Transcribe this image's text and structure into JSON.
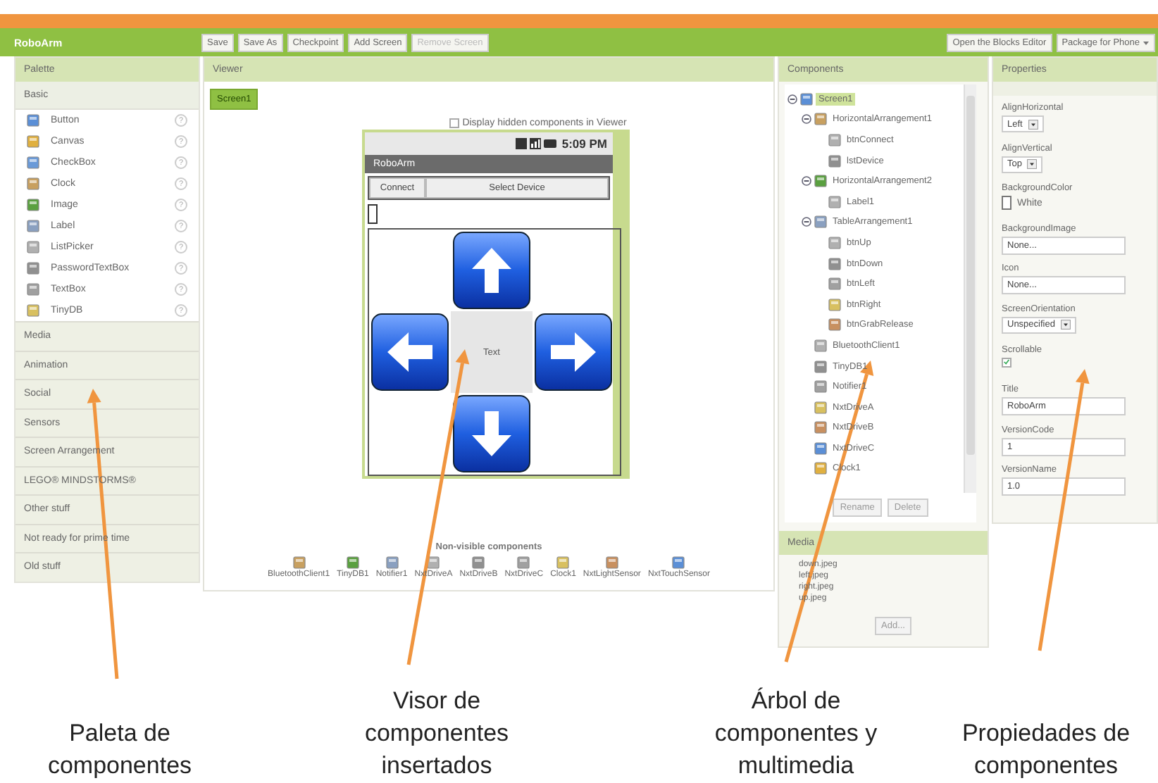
{
  "toolbar": {
    "project": "RoboArm",
    "buttons": [
      {
        "label": "Save",
        "disabled": false
      },
      {
        "label": "Save As",
        "disabled": false
      },
      {
        "label": "Checkpoint",
        "disabled": false
      },
      {
        "label": "Add Screen",
        "disabled": false
      },
      {
        "label": "Remove Screen",
        "disabled": true
      }
    ],
    "right_buttons": [
      {
        "label": "Open the Blocks Editor",
        "dropdown": false
      },
      {
        "label": "Package for Phone",
        "dropdown": true
      }
    ]
  },
  "palette": {
    "title": "Palette",
    "open_category": "Basic",
    "items": [
      {
        "label": "Button",
        "help": "?"
      },
      {
        "label": "Canvas",
        "help": "?"
      },
      {
        "label": "CheckBox",
        "help": "?"
      },
      {
        "label": "Clock",
        "help": "?"
      },
      {
        "label": "Image",
        "help": "?"
      },
      {
        "label": "Label",
        "help": "?"
      },
      {
        "label": "ListPicker",
        "help": "?"
      },
      {
        "label": "PasswordTextBox",
        "help": "?"
      },
      {
        "label": "TextBox",
        "help": "?"
      },
      {
        "label": "TinyDB",
        "help": "?"
      }
    ],
    "categories": [
      "Media",
      "Animation",
      "Social",
      "Sensors",
      "Screen Arrangement",
      "LEGO® MINDSTORMS®",
      "Other stuff",
      "Not ready for prime time",
      "Old stuff"
    ]
  },
  "viewer": {
    "title": "Viewer",
    "screen_tab": {
      "label": "Screen1",
      "selected": true
    },
    "display_hidden": {
      "label": "Display hidden components in Viewer",
      "checked": false
    },
    "phone": {
      "time": "5:09 PM",
      "app_title": "RoboArm",
      "connect": "Connect",
      "select_device": "Select Device",
      "pad": [
        {
          "kind": "arrow_up"
        },
        {
          "kind": "arrow_left"
        },
        {
          "kind": "center",
          "label": "Text"
        },
        {
          "kind": "arrow_right"
        },
        {
          "kind": "arrow_down"
        }
      ]
    },
    "non_visible_title": "Non-visible components",
    "non_visible": [
      "BluetoothClient1",
      "TinyDB1",
      "Notifier1",
      "NxtDriveA",
      "NxtDriveB",
      "NxtDriveC",
      "Clock1",
      "NxtLightSensor",
      "NxtTouchSensor"
    ]
  },
  "components": {
    "title": "Components",
    "tree": [
      {
        "label": "Screen1",
        "selected": true,
        "expanded": true,
        "children": [
          {
            "label": "HorizontalArrangement1",
            "selected": false,
            "expanded": true,
            "children": [
              {
                "label": "btnConnect",
                "selected": false
              },
              {
                "label": "lstDevice",
                "selected": false
              }
            ]
          },
          {
            "label": "HorizontalArrangement2",
            "selected": false,
            "expanded": true,
            "children": [
              {
                "label": "Label1",
                "selected": false
              }
            ]
          },
          {
            "label": "TableArrangement1",
            "selected": false,
            "expanded": true,
            "children": [
              {
                "label": "btnUp",
                "selected": false
              },
              {
                "label": "btnDown",
                "selected": false
              },
              {
                "label": "btnLeft",
                "selected": false
              },
              {
                "label": "btnRight",
                "selected": false
              },
              {
                "label": "btnGrabRelease",
                "selected": false
              }
            ]
          },
          {
            "label": "BluetoothClient1",
            "selected": false
          },
          {
            "label": "TinyDB1",
            "selected": false
          },
          {
            "label": "Notifier1",
            "selected": false
          },
          {
            "label": "NxtDriveA",
            "selected": false
          },
          {
            "label": "NxtDriveB",
            "selected": false
          },
          {
            "label": "NxtDriveC",
            "selected": false
          },
          {
            "label": "Clock1",
            "selected": false
          }
        ]
      }
    ],
    "buttons": [
      "Rename",
      "Delete"
    ],
    "media_title": "Media",
    "media": [
      "down.jpeg",
      "left.jpeg",
      "right.jpeg",
      "up.jpeg"
    ],
    "add_button": "Add..."
  },
  "properties": {
    "title": "Properties",
    "items": [
      {
        "label": "AlignHorizontal",
        "kind": "dropdown",
        "value": "Left"
      },
      {
        "label": "AlignVertical",
        "kind": "dropdown",
        "value": "Top"
      },
      {
        "label": "BackgroundColor",
        "kind": "color",
        "value": "White"
      },
      {
        "label": "BackgroundImage",
        "kind": "text",
        "value": "None..."
      },
      {
        "label": "Icon",
        "kind": "text",
        "value": "None..."
      },
      {
        "label": "ScreenOrientation",
        "kind": "dropdown",
        "value": "Unspecified"
      },
      {
        "label": "Scrollable",
        "kind": "checkbox",
        "checked": true
      },
      {
        "label": "Title",
        "kind": "text",
        "value": "RoboArm"
      },
      {
        "label": "VersionCode",
        "kind": "text",
        "value": "1"
      },
      {
        "label": "VersionName",
        "kind": "text",
        "value": "1.0"
      }
    ]
  },
  "captions": [
    "Paleta de componentes",
    "Visor de componentes insertados",
    "Árbol de componentes y multimedia",
    "Propiedades de componentes"
  ]
}
